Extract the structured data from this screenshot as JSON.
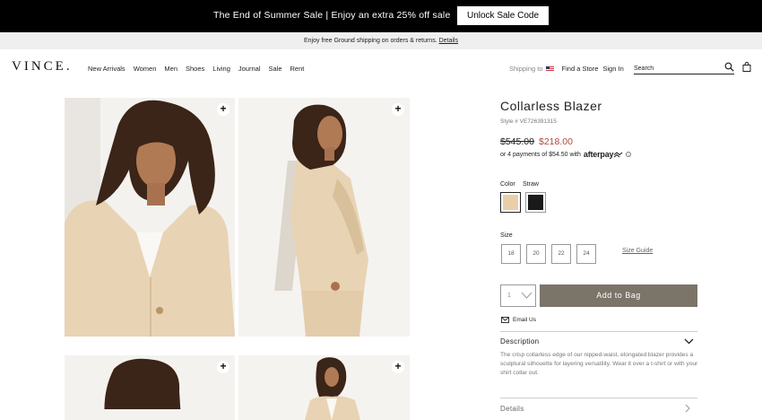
{
  "promo": {
    "text": "The End of Summer Sale | Enjoy an extra 25% off sale",
    "button_label": "Unlock Sale Code"
  },
  "shipping": {
    "text": "Enjoy free Ground shipping on orders & returns.",
    "details_label": "Details"
  },
  "nav": {
    "logo": "VINCE.",
    "links": [
      "New Arrivals",
      "Women",
      "Men",
      "Shoes",
      "Living",
      "Journal",
      "Sale",
      "Rent"
    ],
    "shipping_to_label": "Shipping to",
    "find_store_label": "Find a Store",
    "sign_in_label": "Sign In",
    "search_placeholder": "Search"
  },
  "product": {
    "title": "Collarless Blazer",
    "style_code": "Style # VE726391315",
    "price_original": "$545.00",
    "price_sale": "$218.00",
    "installments_text": "or 4 payments of $54.50 with",
    "afterpay_label": "afterpay",
    "color_label": "Color",
    "color_value": "Straw",
    "colors": [
      {
        "name": "Straw",
        "hex": "#e8cfa8"
      },
      {
        "name": "Black",
        "hex": "#1a1a1a"
      }
    ],
    "size_label": "Size",
    "sizes": [
      "18",
      "20",
      "22",
      "24"
    ],
    "size_guide_label": "Size Guide",
    "quantity": "1",
    "add_to_bag_label": "Add to Bag",
    "email_us_label": "Email Us",
    "description_heading": "Description",
    "description_text": "The crisp collarless edge of our nipped-waist, elongated blazer provides a sculptural silhouette for layering versatility. Wear it over a t-shirt or with your shirt collar out.",
    "details_heading": "Details"
  },
  "colors": {
    "accent_button": "#7a7469",
    "sale_price": "#b3473d",
    "promo_bar": "#000000"
  }
}
